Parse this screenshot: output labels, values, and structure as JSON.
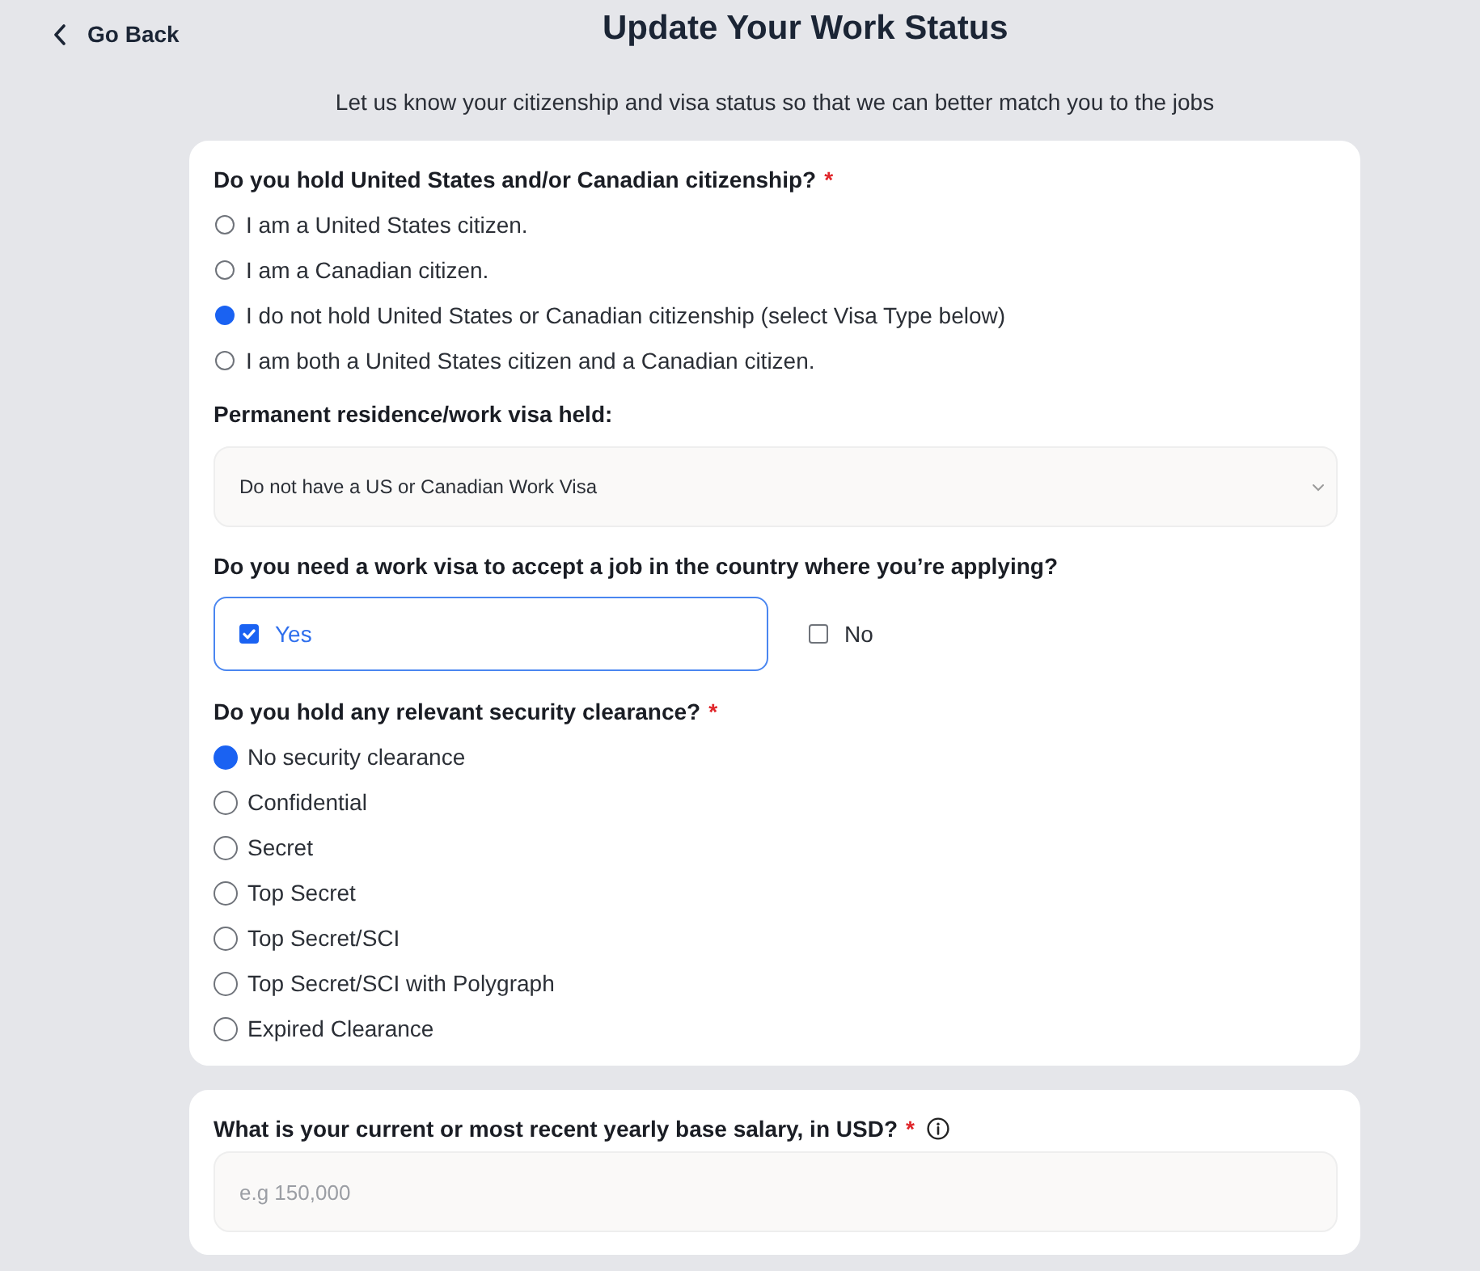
{
  "header": {
    "back_label": "Go Back",
    "title": "Update Your Work Status",
    "subtitle": "Let us know your citizenship and visa status so that we can better match you to the jobs"
  },
  "citizenship": {
    "question": "Do you hold United States and/or Canadian citizenship?",
    "required_mark": "*",
    "options": [
      {
        "label": "I am a United States citizen.",
        "selected": false
      },
      {
        "label": "I am a Canadian citizen.",
        "selected": false
      },
      {
        "label": "I do not hold United States or Canadian citizenship (select Visa Type below)",
        "selected": true
      },
      {
        "label": "I am both a United States citizen and a Canadian citizen.",
        "selected": false
      }
    ]
  },
  "visa_held": {
    "question": "Permanent residence/work visa held:",
    "value": "Do not have a US or Canadian Work Visa"
  },
  "visa_needed": {
    "question": "Do you need a work visa to accept a job in the country where you’re applying?",
    "options": [
      {
        "label": "Yes",
        "checked": true
      },
      {
        "label": "No",
        "checked": false
      }
    ]
  },
  "security_clearance": {
    "question": "Do you hold any relevant security clearance?",
    "required_mark": "*",
    "options": [
      {
        "label": "No security clearance",
        "selected": true
      },
      {
        "label": "Confidential",
        "selected": false
      },
      {
        "label": "Secret",
        "selected": false
      },
      {
        "label": "Top Secret",
        "selected": false
      },
      {
        "label": "Top Secret/SCI",
        "selected": false
      },
      {
        "label": "Top Secret/SCI with Polygraph",
        "selected": false
      },
      {
        "label": "Expired Clearance",
        "selected": false
      }
    ]
  },
  "salary": {
    "question": "What is your current or most recent yearly base salary, in USD?",
    "required_mark": "*",
    "placeholder": "e.g 150,000"
  }
}
